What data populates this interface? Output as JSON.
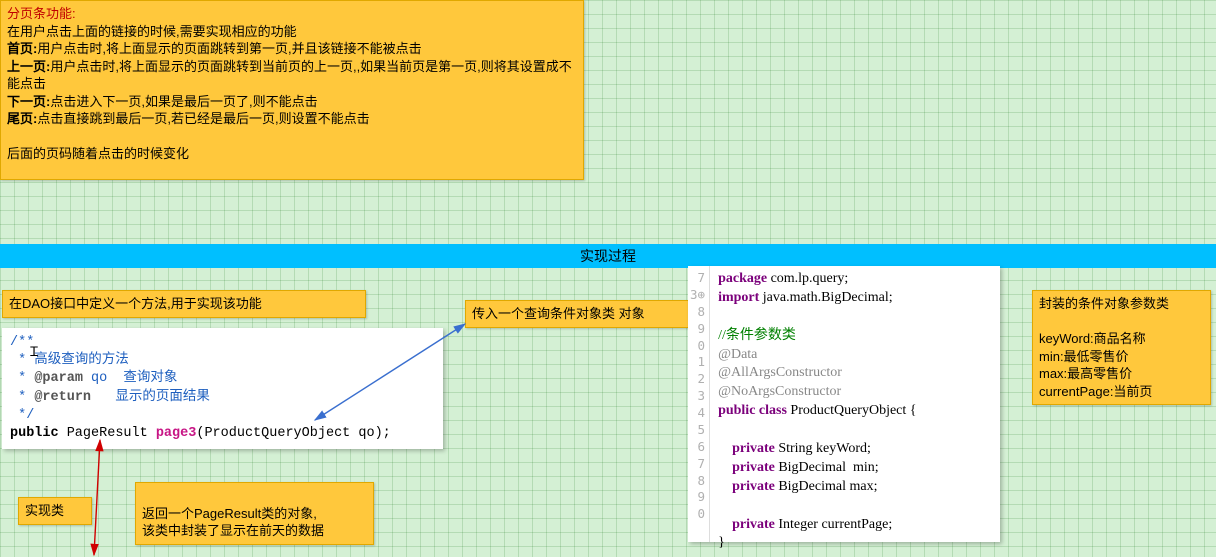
{
  "topNote": {
    "line1_head": "分页条功能:",
    "line2": "在用户点击上面的链接的时候,需要实现相应的功能",
    "line3_label": "首页:",
    "line3_rest": "用户点击时,将上面显示的页面跳转到第一页,并且该链接不能被点击",
    "line4_label": "上一页:",
    "line4_rest": "用户点击时,将上面显示的页面跳转到当前页的上一页,,如果当前页是第一页,则将其设置成不能点击",
    "line5_label": "下一页:",
    "line5_rest": "点击进入下一页,如果是最后一页了,则不能点击",
    "line6_label": "尾页:",
    "line6_rest": "点击直接跳到最后一页,若已经是最后一页,则设置不能点击",
    "line7": "后面的页码随着点击的时候变化"
  },
  "sectionTitle": "实现过程",
  "noteDao": "在DAO接口中定义一个方法,用于实现该功能",
  "noteParam": "传入一个查询条件对象类 对象",
  "noteImpl": "实现类",
  "noteReturn": "返回一个PageResult类的对象,\n该类中封装了显示在前天的数据",
  "noteQO": {
    "title": "封装的条件对象参数类",
    "k1": "keyWord:商品名称",
    "k2": "min:最低零售价",
    "k3": "max:最高零售价",
    "k4": "currentPage:当前页"
  },
  "leftCode": {
    "c1": "/**",
    "c2": " * 高级查询的方法",
    "c3a": " * ",
    "c3b": "@param",
    "c3c": " qo  查询对象",
    "c4a": " * ",
    "c4b": "@return",
    "c4c": "   显示的页面结果",
    "c5": " */",
    "sig_public": "public",
    "sig_type": " PageResult ",
    "sig_method": "page3",
    "sig_rest": "(ProductQueryObject qo);"
  },
  "rightCode": {
    "gutter": "7\n3⊕\n8\n9\n0\n1\n2\n3\n4\n5\n6\n7\n8\n9\n0",
    "l1a": "package",
    "l1b": " com.lp.query;",
    "l2a": "import",
    "l2b": " java.math.BigDecimal;",
    "l3": "//条件参数类",
    "l4": "@Data",
    "l5": "@AllArgsConstructor",
    "l6": "@NoArgsConstructor",
    "l7a": "public class",
    "l7b": " ProductQueryObject {",
    "l8a": "private",
    "l8b": " String keyWord;",
    "l9a": "private",
    "l9b": " BigDecimal  min;",
    "l10a": "private",
    "l10b": " BigDecimal max;",
    "l11a": "private",
    "l11b": " Integer currentPage;",
    "l12": "}"
  }
}
